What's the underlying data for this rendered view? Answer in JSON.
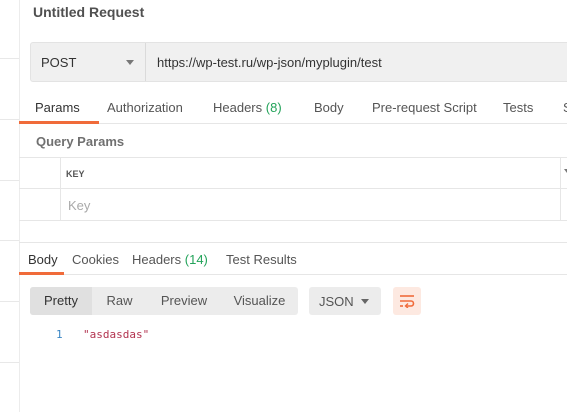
{
  "request": {
    "title": "Untitled Request",
    "method": "POST",
    "url": "https://wp-test.ru/wp-json/myplugin/test"
  },
  "request_tabs": [
    {
      "label": "Params",
      "count": "",
      "active": true
    },
    {
      "label": "Authorization",
      "count": "",
      "active": false
    },
    {
      "label": "Headers",
      "count": "(8)",
      "active": false
    },
    {
      "label": "Body",
      "count": "",
      "active": false
    },
    {
      "label": "Pre-request Script",
      "count": "",
      "active": false
    },
    {
      "label": "Tests",
      "count": "",
      "active": false
    },
    {
      "label": "S",
      "count": "",
      "active": false
    }
  ],
  "query_params": {
    "title": "Query Params",
    "key_header": "KEY",
    "key_placeholder": "Key"
  },
  "response_tabs": [
    {
      "label": "Body",
      "count": "",
      "active": true
    },
    {
      "label": "Cookies",
      "count": "",
      "active": false
    },
    {
      "label": "Headers",
      "count": "(14)",
      "active": false
    },
    {
      "label": "Test Results",
      "count": "",
      "active": false
    }
  ],
  "view_modes": [
    "Pretty",
    "Raw",
    "Preview",
    "Visualize"
  ],
  "active_view_mode": "Pretty",
  "format": "JSON",
  "response_body": [
    {
      "line": "1",
      "text": "\"asdasdas\""
    }
  ],
  "colors": {
    "accent": "#f06b3a",
    "count_green": "#23a35a",
    "code_string": "#b2334f",
    "line_number": "#3b86c4"
  }
}
